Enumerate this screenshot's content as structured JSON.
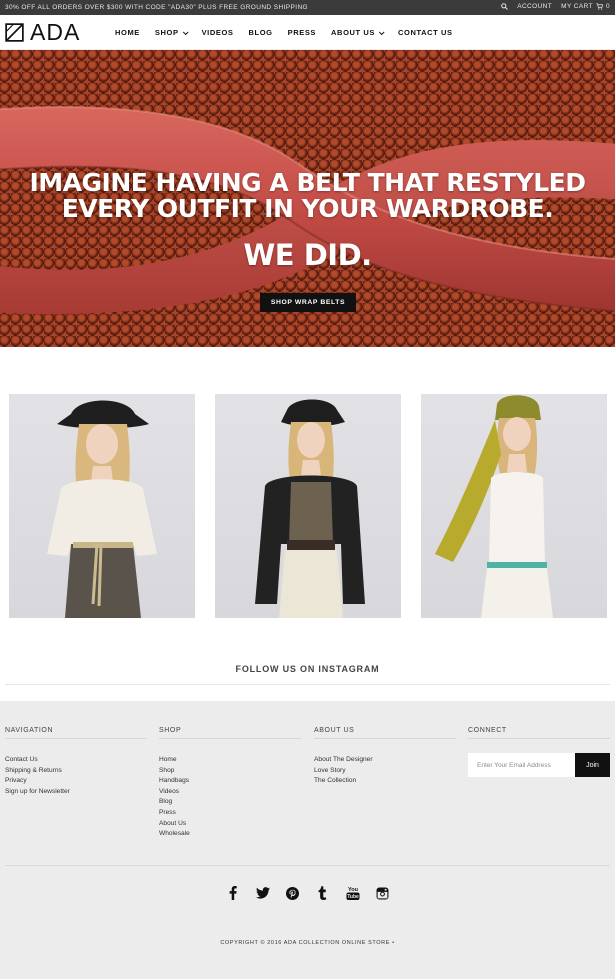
{
  "topbar": {
    "promo": "30% OFF ALL ORDERS OVER $300 WITH CODE \"ADA30\" PLUS FREE GROUND SHIPPING",
    "account": "ACCOUNT",
    "cart": "MY CART",
    "cart_count": "0"
  },
  "header": {
    "logo_text": "ADA",
    "nav": [
      {
        "label": "HOME"
      },
      {
        "label": "SHOP"
      },
      {
        "label": "VIDEOS"
      },
      {
        "label": "BLOG"
      },
      {
        "label": "PRESS"
      },
      {
        "label": "ABOUT US"
      },
      {
        "label": "CONTACT US"
      }
    ]
  },
  "hero": {
    "headline": "IMAGINE HAVING A BELT THAT RESTYLED EVERY OUTFIT IN YOUR WARDROBE.",
    "subheadline": "WE DID.",
    "cta": "SHOP WRAP BELTS"
  },
  "instagram": {
    "title": "FOLLOW US ON INSTAGRAM"
  },
  "footer": {
    "navigation": {
      "heading": "NAVIGATION",
      "links": [
        "Contact Us",
        "Shipping & Returns",
        "Privacy",
        "Sign up for Newsletter"
      ]
    },
    "shop": {
      "heading": "SHOP",
      "links": [
        "Home",
        "Shop",
        "Handbags",
        "Videos",
        "Blog",
        "Press",
        "About Us",
        "Wholesale"
      ]
    },
    "about": {
      "heading": "ABOUT US",
      "links": [
        "About The Designer",
        "Love Story",
        "The Collection"
      ]
    },
    "connect": {
      "heading": "CONNECT",
      "email_placeholder": "Enter Your Email Address",
      "join": "Join"
    },
    "social": [
      "facebook-icon",
      "twitter-icon",
      "pinterest-icon",
      "tumblr-icon",
      "youtube-icon",
      "instagram-icon"
    ],
    "social_labels": {
      "youtube_top": "You",
      "youtube_bottom": "Tube"
    },
    "copyright": "COPYRIGHT © 2016 ADA COLLECTION ONLINE STORE •"
  },
  "colors": {
    "topbar_bg": "#3b3b3b",
    "hero_red": "#c9524b",
    "button_black": "#111111",
    "footer_bg": "#ececec"
  }
}
